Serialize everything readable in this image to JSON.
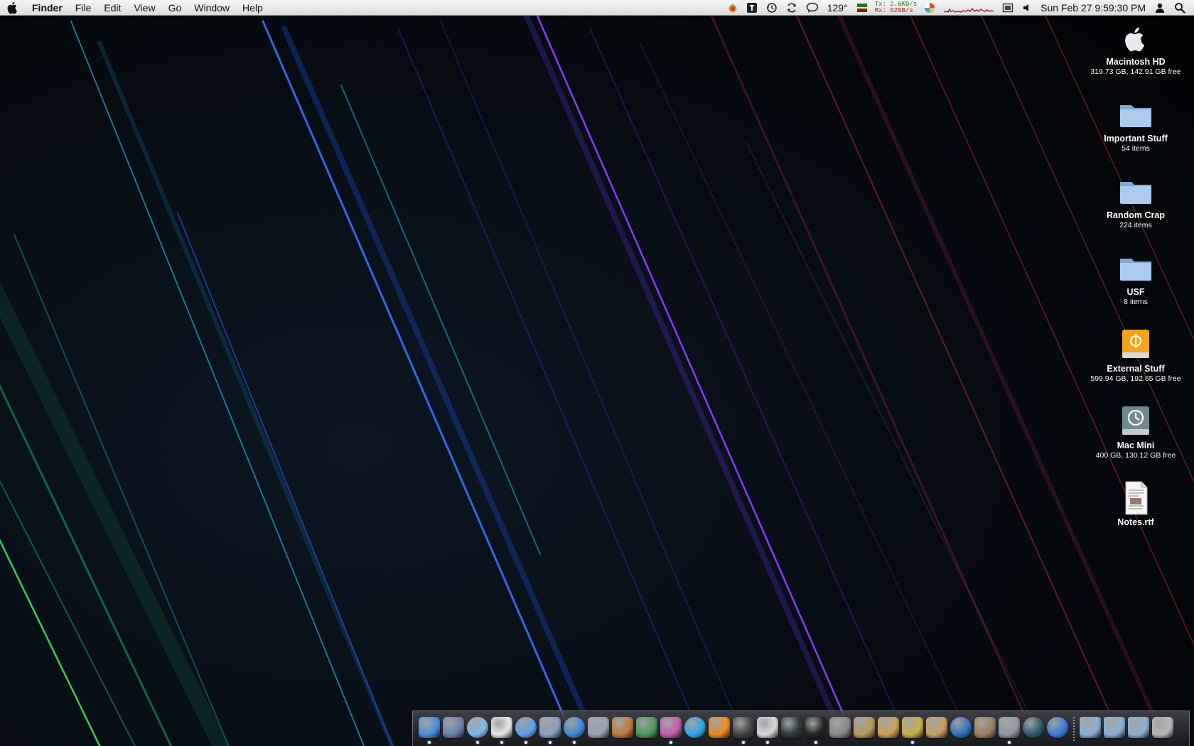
{
  "menubar": {
    "apple_icon": "apple-logo-icon",
    "app_name": "Finder",
    "menus": [
      "File",
      "Edit",
      "View",
      "Go",
      "Window",
      "Help"
    ],
    "status": {
      "temperature": "129°",
      "net_tx_label": "Tx:",
      "net_tx_value": "2.6KB/s",
      "net_rx_label": "Rx:",
      "net_rx_value": "620B/s",
      "clock": "Sun Feb 27  9:59:30 PM"
    }
  },
  "desktop": {
    "icons": [
      {
        "name": "Macintosh HD",
        "info": "319.73 GB, 142.91 GB free",
        "icon": "hard-drive-icon"
      },
      {
        "name": "Important Stuff",
        "info": "54 items",
        "icon": "folder-icon"
      },
      {
        "name": "Random Crap",
        "info": "224 items",
        "icon": "folder-icon"
      },
      {
        "name": "USF",
        "info": "8 items",
        "icon": "folder-icon"
      },
      {
        "name": "External Stuff",
        "info": "599.94 GB, 192.65 GB free",
        "icon": "firewire-drive-icon"
      },
      {
        "name": "Mac Mini",
        "info": "400 GB, 130.12 GB free",
        "icon": "time-machine-drive-icon"
      },
      {
        "name": "Notes.rtf",
        "info": "",
        "icon": "document-icon"
      }
    ]
  },
  "dock": {
    "apps": [
      {
        "icon": "finder-icon",
        "color": "#4a8fe0",
        "running": true
      },
      {
        "icon": "imovie-icon",
        "color": "#6a7fb0",
        "running": false
      },
      {
        "icon": "itunes-icon",
        "color": "#7ab8e8",
        "running": true
      },
      {
        "icon": "calendar-icon",
        "color": "#e8e8e8",
        "running": true
      },
      {
        "icon": "ichat-icon",
        "color": "#5aa0ea",
        "running": true
      },
      {
        "icon": "mail-stamp-icon",
        "color": "#8aa0c0",
        "running": true
      },
      {
        "icon": "safari-icon",
        "color": "#3b8ad8",
        "running": true
      },
      {
        "icon": "pen-icon",
        "color": "#9aa4b4",
        "running": false
      },
      {
        "icon": "keynote-icon",
        "color": "#c07a3a",
        "running": false
      },
      {
        "icon": "numbers-icon",
        "color": "#4a9a5a",
        "running": false
      },
      {
        "icon": "adium-icon",
        "color": "#c75ab0",
        "running": true
      },
      {
        "icon": "skype-icon",
        "color": "#2aa7e8",
        "running": false
      },
      {
        "icon": "vlc-icon",
        "color": "#f08a1a",
        "running": false
      },
      {
        "icon": "photo-booth-icon",
        "color": "#444444",
        "running": true
      },
      {
        "icon": "textedit-icon",
        "color": "#d8d8d8",
        "running": true
      },
      {
        "icon": "activity-monitor-icon",
        "color": "#2a3a3a",
        "running": false
      },
      {
        "icon": "terminal-icon",
        "color": "#222222",
        "running": true
      },
      {
        "icon": "calculator-icon",
        "color": "#8a8a8a",
        "running": false
      },
      {
        "icon": "preview-icon",
        "color": "#b89a5a",
        "running": false
      },
      {
        "icon": "pencil-icon",
        "color": "#d0a050",
        "running": false
      },
      {
        "icon": "transmission-icon",
        "color": "#c8b040",
        "running": true
      },
      {
        "icon": "address-book-icon",
        "color": "#c8a060",
        "running": false
      },
      {
        "icon": "quicktime-icon",
        "color": "#3070c0",
        "running": false
      },
      {
        "icon": "image-capture-icon",
        "color": "#a08060",
        "running": false
      },
      {
        "icon": "system-preferences-icon",
        "color": "#909aa8",
        "running": true
      },
      {
        "icon": "time-machine-icon",
        "color": "#2a5a6a",
        "running": false
      },
      {
        "icon": "app-store-icon",
        "color": "#3a7ad8",
        "running": false
      }
    ],
    "stacks": [
      {
        "icon": "applications-folder-icon",
        "color": "#8ab0d8"
      },
      {
        "icon": "documents-folder-icon",
        "color": "#8ab0d8"
      },
      {
        "icon": "downloads-folder-icon",
        "color": "#8ab0d8"
      },
      {
        "icon": "trash-icon",
        "color": "#b8b8b8"
      }
    ]
  }
}
